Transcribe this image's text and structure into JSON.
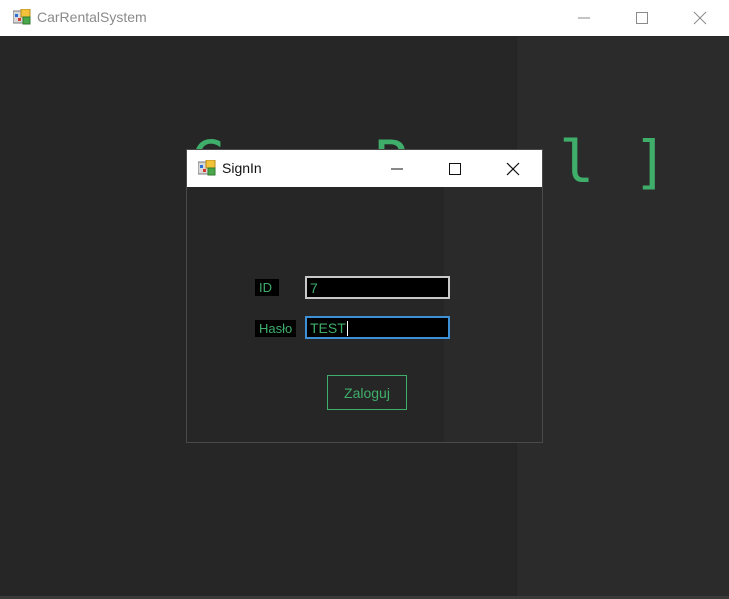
{
  "main_window": {
    "title": "CarRentalSystem",
    "background_title": "C    R    l ]"
  },
  "dialog": {
    "title": "SignIn",
    "id_label": "ID",
    "id_value": "7",
    "password_label": "Hasło",
    "password_value": "TEST",
    "login_button": "Zaloguj"
  },
  "colors": {
    "accent": "#3fae6a",
    "background": "#262626",
    "input_bg": "#000000",
    "focus_border": "#3d8fd6"
  }
}
